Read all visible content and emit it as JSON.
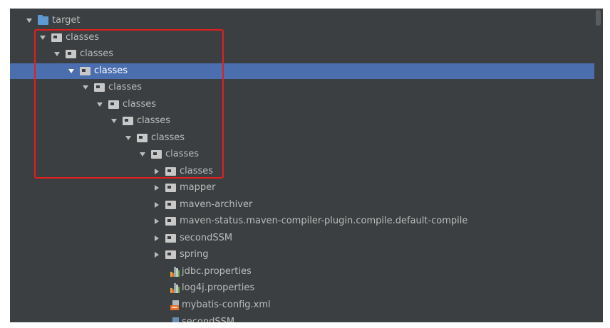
{
  "project_tree": {
    "rows": [
      {
        "label": "target",
        "kind": "folder-blue",
        "expanded": true
      },
      {
        "label": "classes",
        "kind": "folder",
        "expanded": true
      },
      {
        "label": "classes",
        "kind": "folder",
        "expanded": true
      },
      {
        "label": "classes",
        "kind": "folder",
        "expanded": true,
        "selected": true
      },
      {
        "label": "classes",
        "kind": "folder",
        "expanded": true
      },
      {
        "label": "classes",
        "kind": "folder",
        "expanded": true
      },
      {
        "label": "classes",
        "kind": "folder",
        "expanded": true
      },
      {
        "label": "classes",
        "kind": "folder",
        "expanded": true
      },
      {
        "label": "classes",
        "kind": "folder",
        "expanded": true
      },
      {
        "label": "classes",
        "kind": "folder",
        "expanded": false
      },
      {
        "label": "mapper",
        "kind": "folder",
        "expanded": false
      },
      {
        "label": "maven-archiver",
        "kind": "folder",
        "expanded": false
      },
      {
        "label": "maven-status.maven-compiler-plugin.compile.default-compile",
        "kind": "folder",
        "expanded": false
      },
      {
        "label": "secondSSM",
        "kind": "folder",
        "expanded": false
      },
      {
        "label": "spring",
        "kind": "folder",
        "expanded": false
      },
      {
        "label": "jdbc.properties",
        "kind": "properties-file"
      },
      {
        "label": "log4j.properties",
        "kind": "properties-file"
      },
      {
        "label": "mybatis-config.xml",
        "kind": "xml-file"
      },
      {
        "label": "secondSSM",
        "kind": "file"
      }
    ]
  },
  "colors": {
    "panel_background": "#3c3f41",
    "selection": "#4b6eaf",
    "text": "#bbbbbb",
    "highlight_box": "#e0201f",
    "target_folder": "#5c9ad1"
  },
  "icons": {
    "expanded_arrow": "triangle-down-icon",
    "collapsed_arrow": "triangle-right-icon",
    "folder": "folder-icon",
    "properties": "properties-file-icon",
    "xml": "xml-file-icon"
  }
}
